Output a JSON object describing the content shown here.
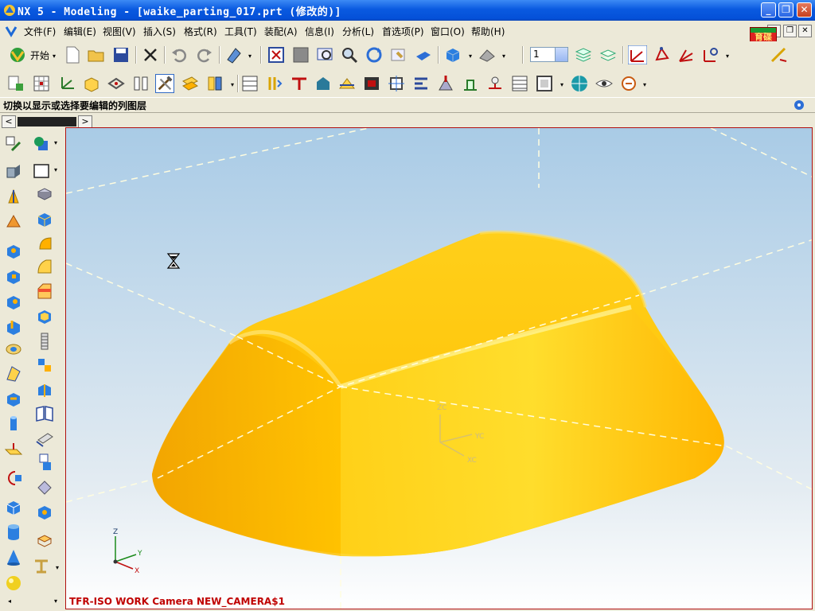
{
  "window": {
    "title": "NX 5 - Modeling - [waike_parting_017.prt (修改的)]",
    "minimize_label": "_",
    "restore_label": "❐",
    "close_label": "✕"
  },
  "menu": {
    "items": [
      "文件(F)",
      "编辑(E)",
      "视图(V)",
      "插入(S)",
      "格式(R)",
      "工具(T)",
      "装配(A)",
      "信息(I)",
      "分析(L)",
      "首选项(P)",
      "窗口(O)",
      "帮助(H)"
    ]
  },
  "brand": {
    "text": "育碟软件"
  },
  "toolbar": {
    "start_label": "开始",
    "layer_value": "1"
  },
  "status": {
    "message": "切换以显示或选择要编辑的列图层"
  },
  "viewport": {
    "camera_label": "TFR-ISO WORK Camera NEW_CAMERA$1",
    "part_color": "#ffc000",
    "background_top": "#a9cbe6",
    "background_bottom": "#ffffff",
    "triad": {
      "z": "Z",
      "y": "Y",
      "x": "X"
    },
    "work_triad": {
      "z": "ZC",
      "y": "YC",
      "x": "XC"
    }
  },
  "icons": {
    "left_toolbar": [
      "sketch-icon",
      "extrude-icon",
      "revolve-icon",
      "sweep-icon",
      "block-icon",
      "cylinder-icon",
      "cone-icon",
      "sphere-icon",
      "hole-icon",
      "boss-icon",
      "pocket-icon",
      "pad-icon",
      "slot-icon",
      "groove-icon",
      "datum-plane-icon",
      "datum-axis-icon",
      "cube-icon",
      "cylinder-solid-icon",
      "cone-solid-icon",
      "sphere-solid-icon"
    ],
    "hourglass": "hourglass-icon"
  }
}
